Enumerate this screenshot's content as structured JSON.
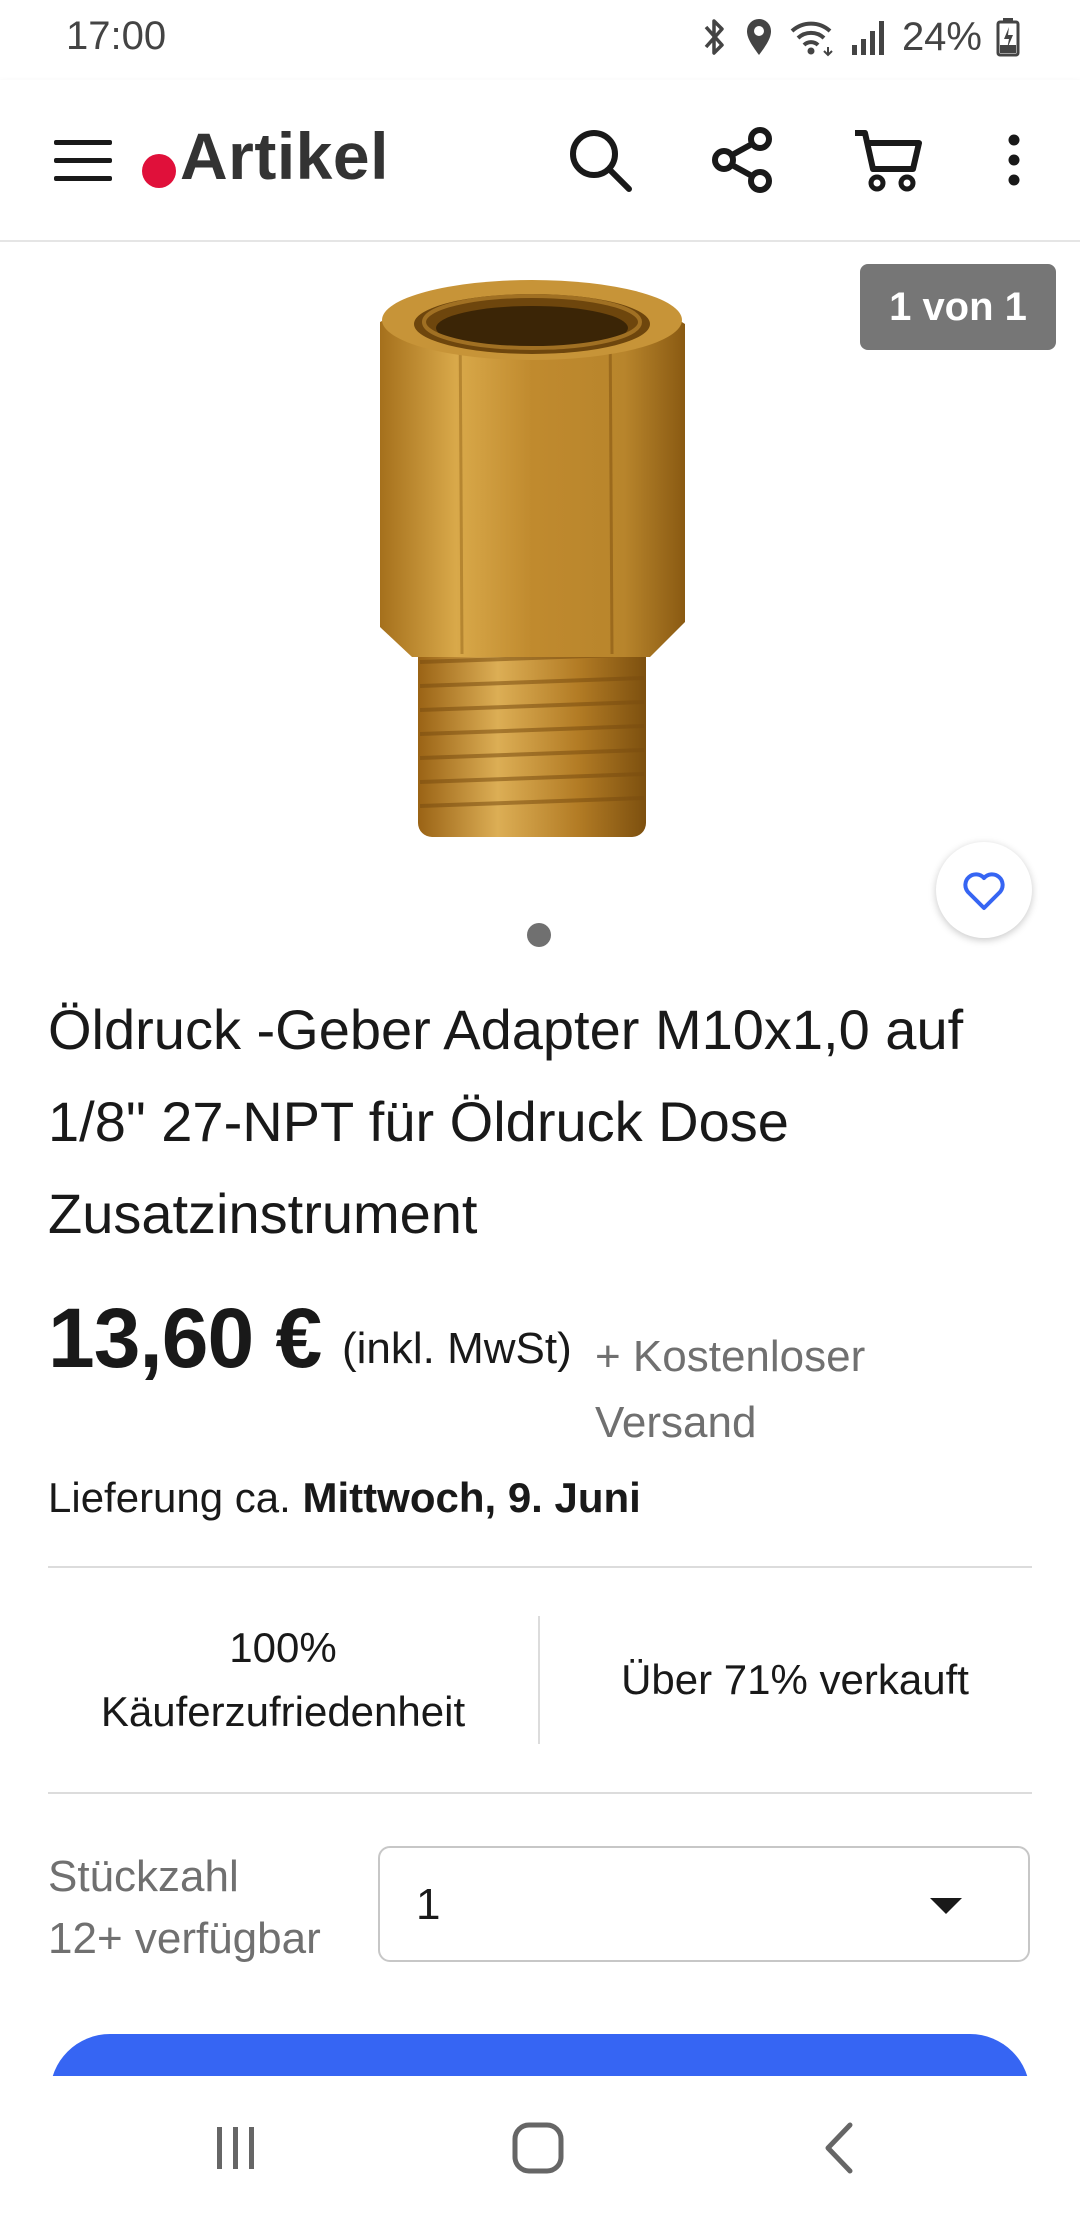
{
  "status_bar": {
    "time": "17:00",
    "battery": "24%",
    "icons": [
      "bluetooth-icon",
      "location-icon",
      "wifi-icon",
      "signal-icon",
      "battery-icon"
    ]
  },
  "app_bar": {
    "title": "Artikel",
    "icons": [
      "menu-icon",
      "search-icon",
      "share-icon",
      "cart-icon",
      "more-vertical-icon"
    ],
    "notification_color": "#e0103a"
  },
  "gallery": {
    "counter": "1 von 1"
  },
  "product": {
    "title": "Öldruck -Geber Adapter M10x1,0 auf 1/8\" 27-NPT für Öldruck Dose Zusatzinstrument",
    "price": "13,60 €",
    "tax_note": "(inkl. MwSt)",
    "shipping": "+ Kostenloser Versand",
    "delivery_prefix": "Lieferung ca.",
    "delivery_date": "Mittwoch, 9. Juni"
  },
  "stats": {
    "satisfaction_value": "100%",
    "satisfaction_label": "Käuferzufriedenheit",
    "sold": "Über 71% verkauft"
  },
  "quantity": {
    "label": "Stückzahl",
    "available": "12+ verfügbar",
    "selected": "1"
  },
  "colors": {
    "accent": "#3665f3",
    "counter_bg": "#767676"
  }
}
